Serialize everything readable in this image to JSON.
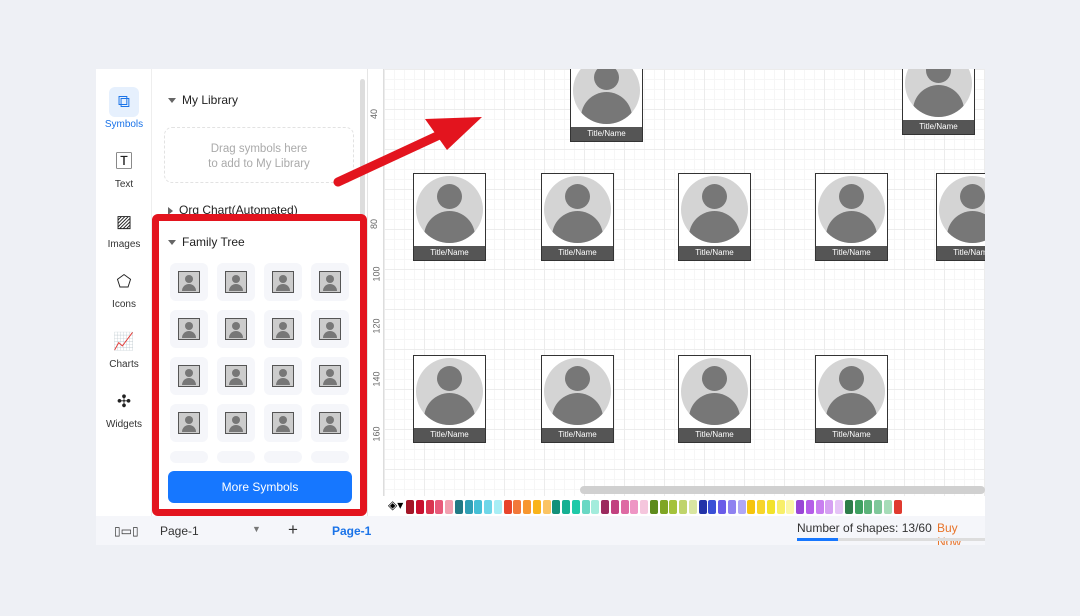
{
  "rail": [
    {
      "label": "Symbols",
      "icon": "symbols-icon",
      "active": true
    },
    {
      "label": "Text",
      "icon": "text-icon"
    },
    {
      "label": "Images",
      "icon": "image-icon"
    },
    {
      "label": "Icons",
      "icon": "icons-icon"
    },
    {
      "label": "Charts",
      "icon": "chart-icon"
    },
    {
      "label": "Widgets",
      "icon": "puzzle-icon"
    }
  ],
  "panel": {
    "my_library": "My Library",
    "drop_line1": "Drag symbols here",
    "drop_line2": "to add to My Library",
    "org_chart": "Org Chart(Automated)",
    "family_tree": "Family Tree",
    "more_symbols": "More Symbols"
  },
  "ruler": [
    "40",
    "80",
    "100",
    "120",
    "140",
    "160"
  ],
  "card_label": "Title/Name",
  "colors": {
    "accent": "#1677ff",
    "highlight": "#e3141e",
    "buy": "#e8742a"
  },
  "palette": [
    "#a31526",
    "#c8102e",
    "#d9344f",
    "#e85a7a",
    "#f2a0b0",
    "#217a85",
    "#2f9fb5",
    "#45bfd6",
    "#6fd6e8",
    "#a8eef5",
    "#e8452c",
    "#f2783a",
    "#f7962f",
    "#f9b31a",
    "#fbc463",
    "#12907a",
    "#16b093",
    "#1fc9a8",
    "#6ad8c4",
    "#a3ecdc",
    "#9b2a5e",
    "#c2417f",
    "#de6aa3",
    "#ee95c4",
    "#f5c6dd",
    "#5e8b1c",
    "#7fa523",
    "#a4c23b",
    "#bfd46b",
    "#d9e6a1",
    "#2333a8",
    "#3a4fd6",
    "#6a5ce8",
    "#8f82f0",
    "#b0a7f5",
    "#f5c40c",
    "#f7d52a",
    "#f2e22b",
    "#f8ef6a",
    "#fbf7a6",
    "#9a45d6",
    "#b55de8",
    "#c97ff0",
    "#d6a0f2",
    "#e6c4f7",
    "#2e7d4a",
    "#3ea060",
    "#5cb37a",
    "#7fc79a",
    "#a6dcb8",
    "#e03a2f"
  ],
  "bottom": {
    "page_select": "Page-1",
    "page_tab": "Page-1",
    "shapes": "Number of shapes: 13/60",
    "buy": "Buy Now",
    "shapes_progress": 0.2167
  }
}
